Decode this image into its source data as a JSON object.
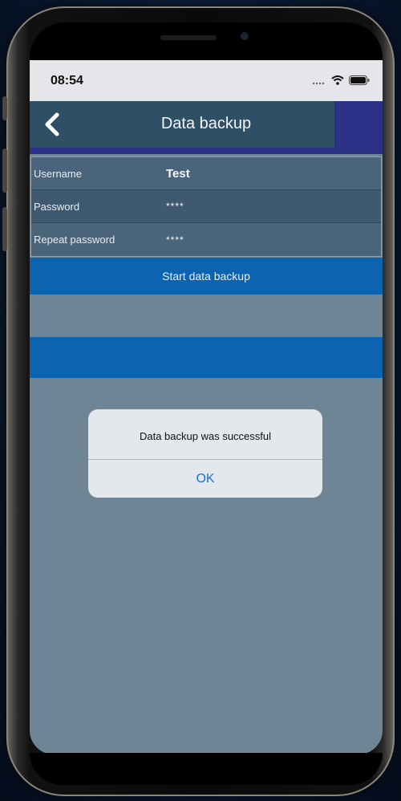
{
  "status_bar": {
    "time": "08:54",
    "icons": [
      "signal-icon",
      "wifi-icon",
      "battery-icon"
    ]
  },
  "nav": {
    "title": "Data backup",
    "back_icon": "chevron-left-icon"
  },
  "form": {
    "rows": [
      {
        "label": "Username",
        "value": "Test"
      },
      {
        "label": "Password",
        "value": "****"
      },
      {
        "label": "Repeat password",
        "value": "****"
      }
    ]
  },
  "actions": {
    "start_label": "Start data backup"
  },
  "dialog": {
    "message": "Data backup was successful",
    "ok_label": "OK"
  },
  "colors": {
    "nav_bar": "#2f4f65",
    "accent": "#2a3187",
    "button": "#0c63b0",
    "screen_bg": "#6e8596",
    "dialog_link": "#1a6fd2"
  }
}
